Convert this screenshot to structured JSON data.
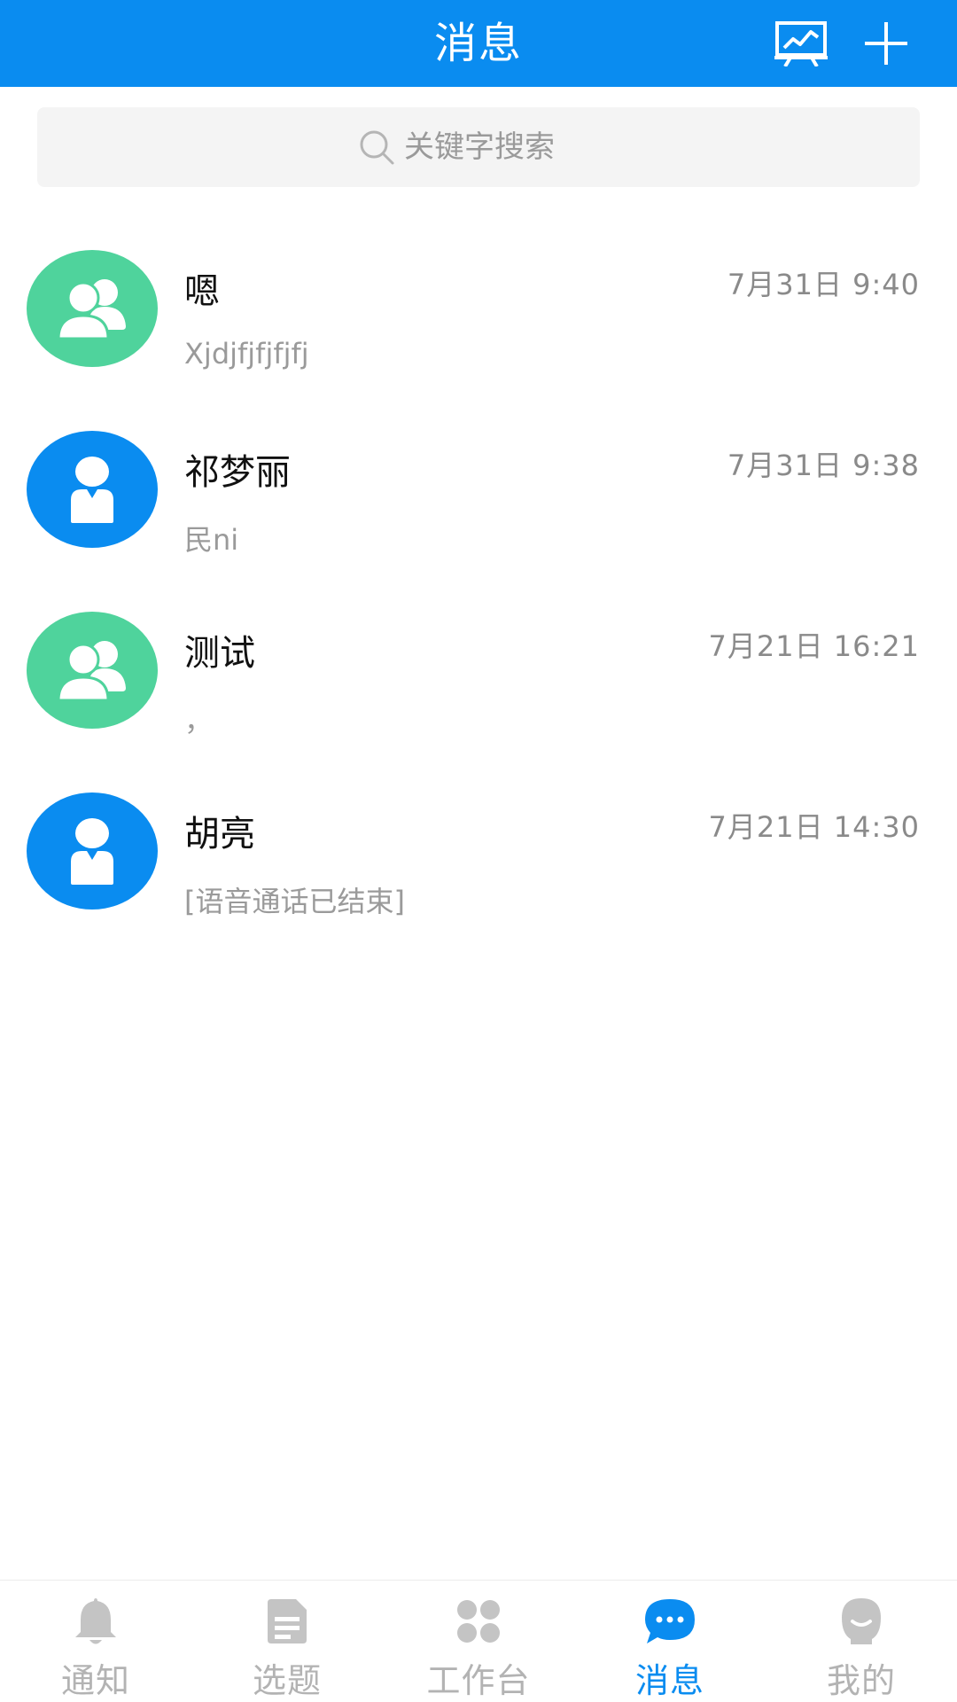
{
  "colors": {
    "primary": "#0a8cf0",
    "group_avatar": "#4fd39c",
    "inactive": "#b3b3b3",
    "time": "#8a8a8a",
    "preview": "#9a9a9a"
  },
  "header": {
    "title": "消息",
    "icons": [
      "chart-board-icon",
      "plus-icon"
    ]
  },
  "search": {
    "placeholder": "关键字搜索",
    "value": ""
  },
  "conversations": [
    {
      "name": "嗯",
      "time": "7月31日 9:40",
      "preview": "Xjdjfjfjfjfj",
      "avatar": "group-icon"
    },
    {
      "name": "祁梦丽",
      "time": "7月31日 9:38",
      "preview": "民ni",
      "avatar": "person-icon"
    },
    {
      "name": "测试",
      "time": "7月21日 16:21",
      "preview": "，",
      "avatar": "group-icon"
    },
    {
      "name": "胡亮",
      "time": "7月21日 14:30",
      "preview": "[语音通话已结束]",
      "avatar": "person-icon"
    }
  ],
  "tabbar": {
    "active": "消息",
    "tabs": [
      {
        "label": "通知",
        "icon": "bell-icon"
      },
      {
        "label": "选题",
        "icon": "document-icon"
      },
      {
        "label": "工作台",
        "icon": "grid-icon"
      },
      {
        "label": "消息",
        "icon": "chat-icon"
      },
      {
        "label": "我的",
        "icon": "profile-icon"
      }
    ]
  }
}
